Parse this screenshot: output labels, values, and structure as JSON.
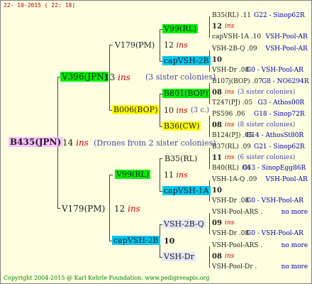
{
  "header": {
    "date": "22- 10-2015 ( 22: 18)"
  },
  "footer": {
    "copyright": "Copyright 2004-2015 @ Karl Kehrle Foundation.   www.pedigreeapis.org"
  },
  "root": {
    "name": "B435(JPN)",
    "num": "14",
    "ins": "ins",
    "note": "(Drones from 2 sister colonies)"
  },
  "g1": {
    "top": {
      "name": "V396(JPN)",
      "num": "13",
      "ins": "ins",
      "note": "(3 sister colonies)"
    },
    "bottom": {
      "name": "V179(PM)",
      "num": "12",
      "ins": "ins"
    }
  },
  "g2": {
    "a": {
      "name": "V179(PM)",
      "num": "12",
      "ins": "ins"
    },
    "b": {
      "name": "B006(BOP)",
      "num": "10",
      "ins": "ins",
      "note": "(3 c.)"
    },
    "c": {
      "name": "V99(RL)",
      "num": "12",
      "ins": "ins"
    },
    "d": {
      "name": "capVSH-2B",
      "num": "10"
    }
  },
  "g3": {
    "a1": {
      "name": "V99(RL)",
      "num": "12",
      "ins": "ins"
    },
    "a2": {
      "name": "capVSH-2B",
      "num": "10"
    },
    "b1": {
      "name": "B801(BOP)",
      "num": "08",
      "ins": "ins"
    },
    "b2": {
      "name": "B36(CW)",
      "num": "08",
      "ins": "ins"
    },
    "c1": {
      "name": "B35(RL)",
      "num": "11",
      "ins": "ins"
    },
    "c2": {
      "name": "capVSH-1A",
      "num": "10"
    },
    "d1": {
      "name": "VSH-2B-Q",
      "num": "09",
      "ins": "ins"
    },
    "d2": {
      "name": "VSH-Dr",
      "num": "08",
      "ins": "ins"
    }
  },
  "g4": [
    {
      "l1": "B35(RL) .11",
      "l1b": "G22 - Sinop62R",
      "mid": "12",
      "ins": "ins",
      "l2": "capVSH-1A .10",
      "l2b": "VSH-Pool-AR"
    },
    {
      "l1": "VSH-2B-Q .09",
      "l1b": "VSH-Pool-AR",
      "mid": "10",
      "ins": "",
      "l2": "VSH-Dr .08",
      "l2b": "G0 - VSH-Pool-AR"
    },
    {
      "l1": "B107j(BOP) .07",
      "l1b": "G8 - NO6294R",
      "mid": "08",
      "ins": "ins",
      "note": "(3 sister colonies)",
      "l2": "T247(PJ) .05",
      "l2b": "G3 - Athos00R"
    },
    {
      "l1": "PS596 .06",
      "l1b": "G18 - Sinop72R",
      "mid": "08",
      "ins": "ins",
      "note": "(8 sister colonies)",
      "l2": "B124(PJ) .05",
      "l2b": "G14 - AthosSt80R"
    },
    {
      "l1": "B37(RL) .09",
      "l1b": "G21 - Sinop62R",
      "mid": "11",
      "ins": "ins",
      "note": "(6 sister colonies)",
      "l2": "B40(RL) .06",
      "l2b": "G13 - SinopEgg86R"
    },
    {
      "l1": "VSH-1A-Q .09",
      "l1b": "VSH-Pool-AR",
      "mid": "10",
      "ins": "",
      "l2": "VSH-Dr .08",
      "l2b": "G0 - VSH-Pool-AR"
    },
    {
      "l1": "VSH-Pool-ARS .",
      "l1b": "no more",
      "mid": "09",
      "ins": "ins",
      "l2": "VSH-Dr .08",
      "l2b": "G0 - VSH-Pool-AR"
    },
    {
      "l1": "VSH-Pool-ARS .",
      "l1b": "no more",
      "mid": "08",
      "ins": "ins",
      "l2": "VSH-Pool-Dr .",
      "l2b": "no more"
    }
  ]
}
